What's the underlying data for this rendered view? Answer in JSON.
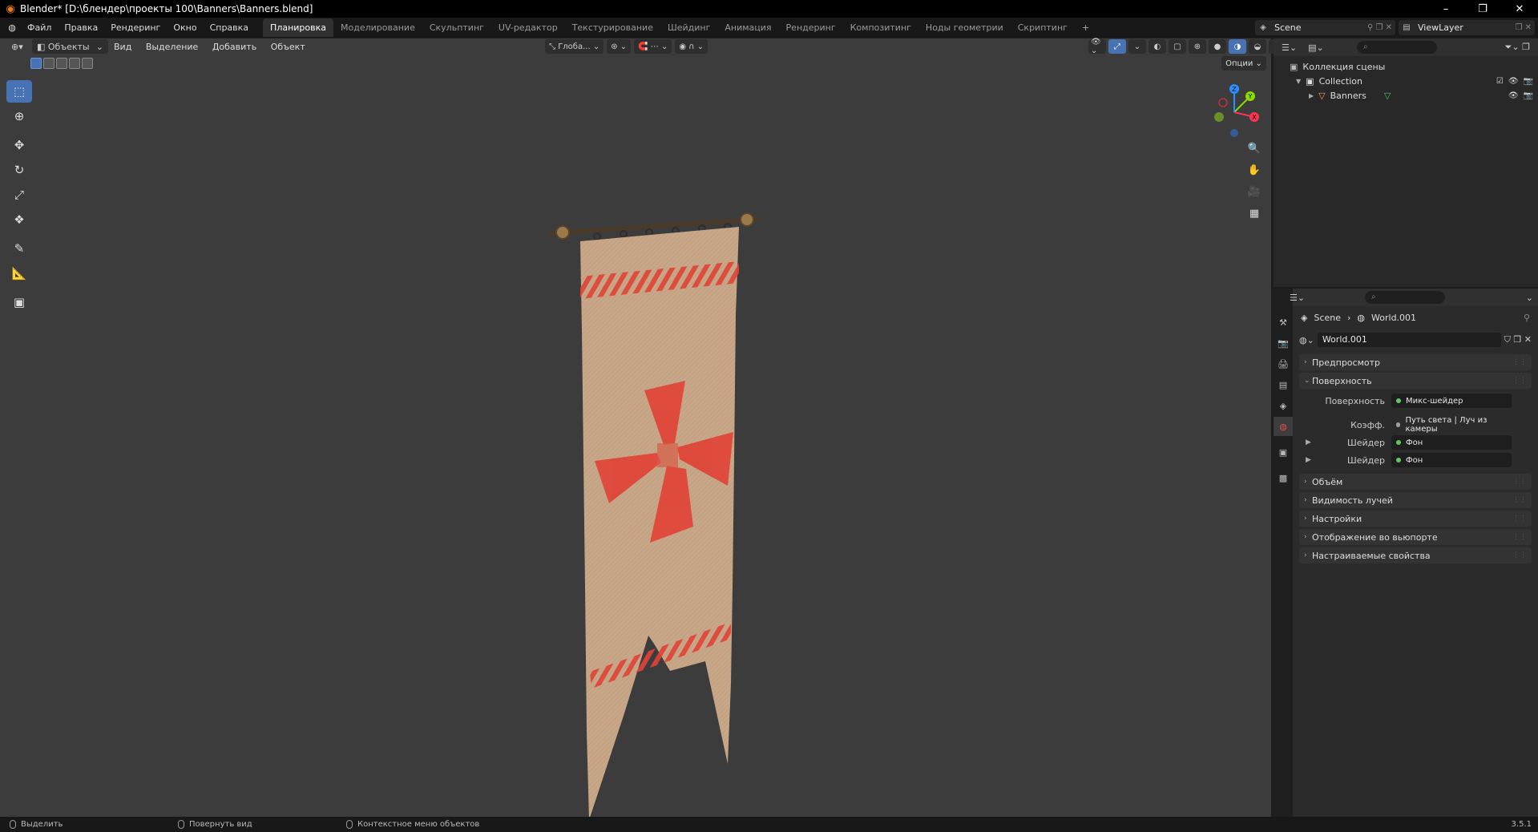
{
  "titlebar": {
    "title": "Blender* [D:\\блендер\\проекты 100\\Banners\\Banners.blend]",
    "minimize": "–",
    "maximize": "❐",
    "close": "✕"
  },
  "menu": [
    "Файл",
    "Правка",
    "Рендеринг",
    "Окно",
    "Справка"
  ],
  "workspaces": [
    {
      "label": "Планировка",
      "active": true
    },
    {
      "label": "Моделирование"
    },
    {
      "label": "Скульптинг"
    },
    {
      "label": "UV-редактор"
    },
    {
      "label": "Текстурирование"
    },
    {
      "label": "Шейдинг"
    },
    {
      "label": "Анимация"
    },
    {
      "label": "Рендеринг"
    },
    {
      "label": "Композитинг"
    },
    {
      "label": "Ноды геометрии"
    },
    {
      "label": "Скриптинг"
    }
  ],
  "add_workspace": "+",
  "scene_selector": "Scene",
  "viewlayer_selector": "ViewLayer",
  "viewport": {
    "mode": "Объекты",
    "menus": [
      "Вид",
      "Выделение",
      "Добавить",
      "Объект"
    ],
    "transform_orientation": "Глоба...",
    "options": "Опции"
  },
  "outliner": {
    "scene_collection": "Коллекция сцены",
    "collection": "Collection",
    "object": "Banners"
  },
  "properties": {
    "breadcrumb_scene": "Scene",
    "breadcrumb_world": "World.001",
    "world_name": "World.001",
    "panels": {
      "preview": "Предпросмотр",
      "surface": "Поверхность",
      "volume": "Объём",
      "ray_visibility": "Видимость лучей",
      "settings": "Настройки",
      "viewport_display": "Отображение во вьюпорте",
      "custom_props": "Настраиваемые свойства"
    },
    "surface_label": "Поверхность",
    "surface_value": "Микс-шейдер",
    "factor_label": "Коэфф.",
    "factor_value": "Путь света | Луч из камеры",
    "shader1_label": "Шейдер",
    "shader1_value": "Фон",
    "shader2_label": "Шейдер",
    "shader2_value": "Фон"
  },
  "statusbar": {
    "select": "Выделить",
    "rotate": "Повернуть вид",
    "context": "Контекстное меню объектов",
    "version": "3.5.1"
  },
  "gizmo": {
    "x": "X",
    "y": "Y",
    "z": "Z"
  },
  "colors": {
    "accent": "#4772b3",
    "banner_cloth": "#c8a888",
    "banner_red": "#e03a34"
  }
}
